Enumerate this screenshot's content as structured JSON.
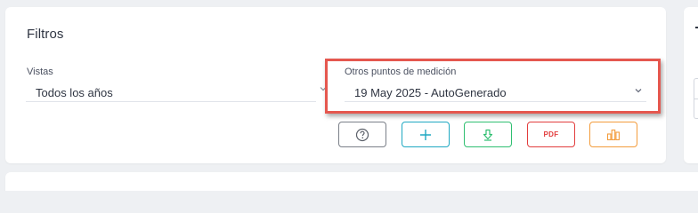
{
  "filters": {
    "title": "Filtros",
    "vistas": {
      "label": "Vistas",
      "value": "Todos los años"
    },
    "otros": {
      "label": "Otros puntos de medición",
      "value": "19 May 2025 - AutoGenerado"
    }
  },
  "actions": {
    "pdf_label": "PDF",
    "icons": [
      "help-icon",
      "plus-icon",
      "download-icon",
      "pdf-icon",
      "chart-icon"
    ],
    "colors": {
      "help": "#7a7f88",
      "add": "#1fa8c2",
      "download": "#2fbf71",
      "pdf": "#e23d3d",
      "chart": "#f39c3c"
    }
  },
  "highlight_color": "#e5574f"
}
